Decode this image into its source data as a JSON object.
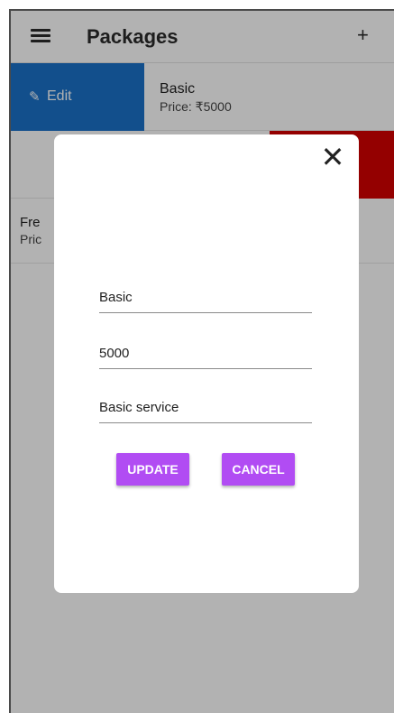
{
  "appbar": {
    "title": "Packages",
    "add_label": "+"
  },
  "packages": [
    {
      "name": "Basic",
      "price": "Price: ₹5000",
      "edit_label": "Edit"
    },
    {
      "name": "",
      "price": ""
    },
    {
      "name": "Fre",
      "price": "Pric"
    }
  ],
  "modal": {
    "close_label": "✕",
    "fields": {
      "name": "Basic",
      "price": "5000",
      "description": "Basic service"
    },
    "update_label": "UPDATE",
    "cancel_label": "CANCEL"
  },
  "colors": {
    "edit_action": "#1a72c9",
    "delete_action": "#d40000",
    "button_accent": "#b14cf3"
  }
}
